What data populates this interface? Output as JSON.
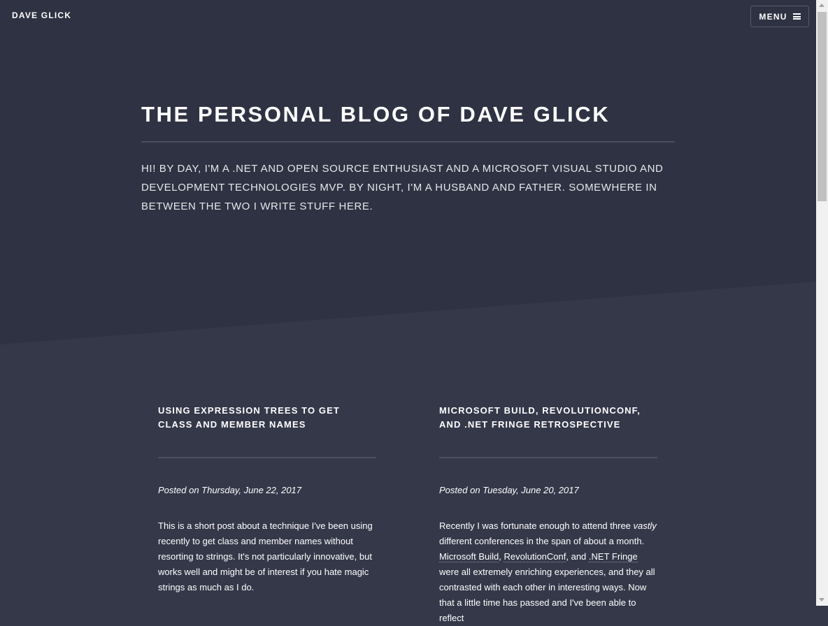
{
  "header": {
    "brand": "DAVE GLICK",
    "menu_label": "MENU",
    "menu_icon": "hamburger-icon"
  },
  "banner": {
    "title": "THE PERSONAL BLOG OF DAVE GLICK",
    "intro": "HI! BY DAY, I'M A .NET AND OPEN SOURCE ENTHUSIAST AND A MICROSOFT VISUAL STUDIO AND DEVELOPMENT TECHNOLOGIES MVP. BY NIGHT, I'M A HUSBAND AND FATHER. SOMEWHERE IN BETWEEN THE TWO I WRITE STUFF HERE."
  },
  "posts": [
    {
      "title": "USING EXPRESSION TREES TO GET CLASS AND MEMBER NAMES",
      "date": "Posted on Thursday, June 22, 2017",
      "body": "This is a short post about a technique I've been using recently to get class and member names without resorting to strings. It's not particularly innovative, but works well and might be of interest if you hate magic strings as much as I do."
    },
    {
      "title": "MICROSOFT BUILD, REVOLUTIONCONF, AND .NET FRINGE RETROSPECTIVE",
      "date": "Posted on Tuesday, June 20, 2017",
      "body_parts": {
        "p1": "Recently I was fortunate enough to attend three ",
        "emph": "vastly",
        "p2": " different conferences in the span of about a month. ",
        "link1": "Microsoft Build",
        "sep1": ", ",
        "link2": "RevolutionConf",
        "sep2": ", and ",
        "link3": ".NET Fringe",
        "p3": " were all extremely enriching experiences, and they all contrasted with each other in interesting ways. Now that a little time has passed and I've been able to reflect"
      }
    }
  ],
  "colors": {
    "page_bg": "#353849",
    "banner_bg": "#2f3242",
    "text": "#ffffff",
    "rule": "#4a4e60"
  }
}
